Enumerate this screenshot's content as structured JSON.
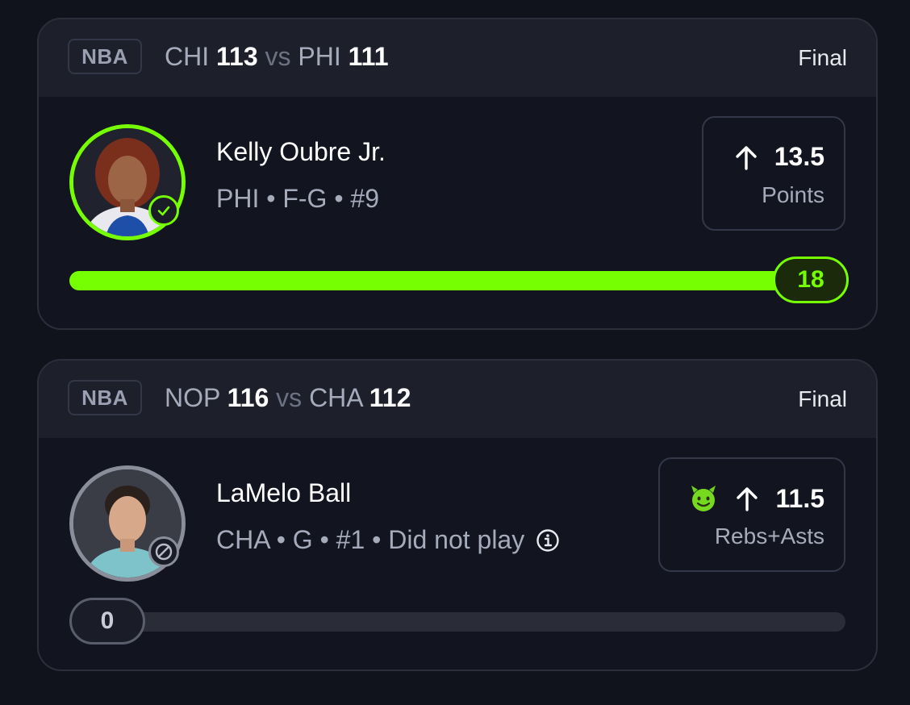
{
  "colors": {
    "accent": "#76ff03",
    "background": "#10121c",
    "header": "#1d1f2b"
  },
  "picks": [
    {
      "league": "NBA",
      "away_team": "CHI",
      "away_score": "113",
      "vs": "vs",
      "home_team": "PHI",
      "home_score": "111",
      "status": "Final",
      "player_name": "Kelly Oubre Jr.",
      "player_meta": "PHI • F-G • #9",
      "avatar_icon": "player-headshot",
      "badge_icon": "check-circle-icon",
      "direction_icon": "arrow-up-icon",
      "line": "13.5",
      "stat": "Points",
      "result": "18",
      "progress": 1.0
    },
    {
      "league": "NBA",
      "away_team": "NOP",
      "away_score": "116",
      "vs": "vs",
      "home_team": "CHA",
      "home_score": "112",
      "status": "Final",
      "player_name": "LaMelo Ball",
      "player_meta": "CHA • G • #1 • Did not play",
      "avatar_icon": "player-headshot",
      "badge_icon": "ban-icon",
      "modifier_icon": "devil-emoji-icon",
      "direction_icon": "arrow-up-icon",
      "line": "11.5",
      "stat": "Rebs+Asts",
      "result": "0",
      "progress": 0.0
    }
  ]
}
